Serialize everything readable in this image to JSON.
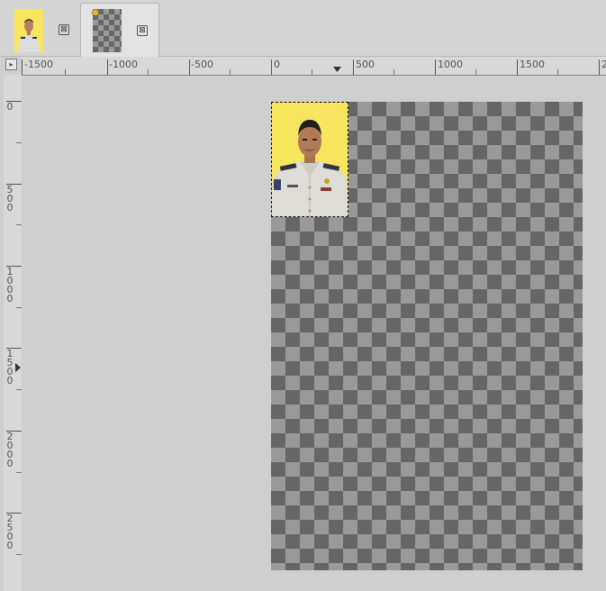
{
  "tabs": [
    {
      "name": "photo-image-tab",
      "thumbnail": "photo-thumbnail",
      "close_glyph": "⊠"
    },
    {
      "name": "transparent-image-tab",
      "thumbnail": "transparent-thumbnail",
      "close_glyph": "⊠",
      "active": true
    }
  ],
  "corner": {
    "glyph": "▸"
  },
  "hruler": {
    "labels": [
      "-1500",
      "-1000",
      "-500",
      "0",
      "500",
      "1000",
      "1500",
      "2"
    ]
  },
  "vruler": {
    "labels": [
      "0",
      "500",
      "1000",
      "1500",
      "2000",
      "2500"
    ]
  },
  "colors": {
    "photo_background": "#f7e55e",
    "checker_dark": "#666666",
    "checker_light": "#999999",
    "workspace": "#cfcfcf"
  },
  "icons": {
    "close": "close-icon",
    "ruler_marker": "triangle-marker-icon",
    "dirty_image": "dirty-image-icon"
  }
}
